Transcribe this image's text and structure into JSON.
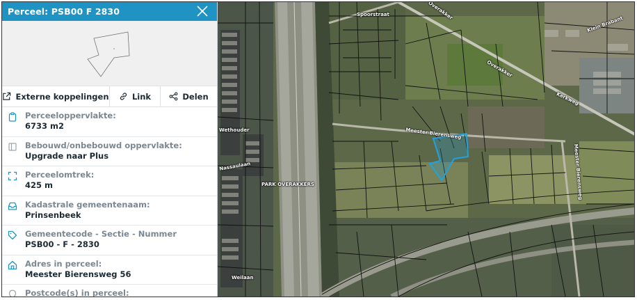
{
  "panel": {
    "title": "Perceel: PSB00 F 2830"
  },
  "actions": {
    "external": "Externe koppelingen",
    "link": "Link",
    "share": "Delen"
  },
  "properties": [
    {
      "label": "Perceeloppervlakte:",
      "value": "6733 m2",
      "icon": "clipboard-icon"
    },
    {
      "label": "Bebouwd/onbebouwd oppervlakte:",
      "value": "Upgrade naar Plus",
      "icon": "square-icon"
    },
    {
      "label": "Perceelomtrek:",
      "value": "425 m",
      "icon": "frame-corners-icon"
    },
    {
      "label": "Kadastrale gemeentenaam:",
      "value": "Prinsenbeek",
      "icon": "inbox-icon"
    },
    {
      "label": "Gemeentecode - Sectie - Nummer",
      "value": "PSB00 - F - 2830",
      "icon": "tag-icon"
    },
    {
      "label": "Adres in perceel:",
      "value": "Meester Bierensweg 56",
      "icon": "home-icon"
    },
    {
      "label": "Postcode(s) in perceel:",
      "value": "",
      "icon": "pin-icon"
    }
  ],
  "map": {
    "labels": {
      "street_top": "Spoorstraat",
      "street_right_1": "Overakker",
      "street_right_2": "Overakker",
      "street_far_right": "Klein Brabant",
      "street_mid": "Meester Bierensweg",
      "street_vert": "Meester Bierensweg",
      "park": "PARK OVERAKKERS",
      "street_left": "Wethouder",
      "street_left_2": "Nassaulaan",
      "street_bottom_left": "Weilaan",
      "street_right_top": "Kerkweg"
    }
  },
  "colors": {
    "header": "#1e93c4",
    "highlight": "#1fa3e0"
  }
}
